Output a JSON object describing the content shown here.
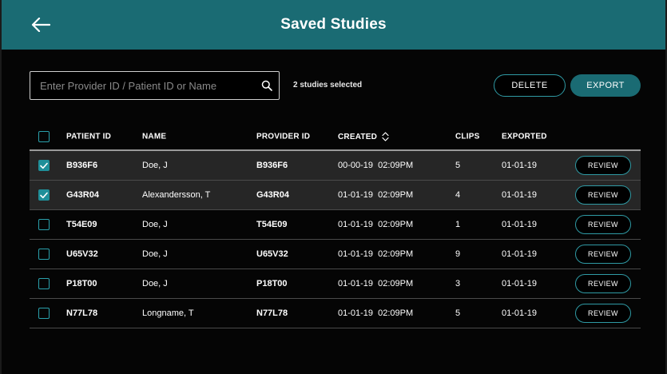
{
  "header": {
    "title": "Saved Studies",
    "back_icon": "arrow-left-icon"
  },
  "toolbar": {
    "search_placeholder": "Enter Provider ID / Patient ID or Name",
    "search_value": "",
    "search_icon": "search-icon",
    "selected_count": "2 studies selected",
    "delete_label": "DELETE",
    "export_label": "EXPORT"
  },
  "colors": {
    "header_bg": "#1a6b73",
    "accent": "#2aa0ab",
    "export_bg": "#1a6b73"
  },
  "table": {
    "columns": {
      "patient_id": "PATIENT ID",
      "name": "NAME",
      "provider_id": "PROVIDER ID",
      "created": "CREATED",
      "clips": "CLIPS",
      "exported": "EXPORTED"
    },
    "header_checked": false,
    "sort_icon": "sort-updown-icon",
    "review_label": "REVIEW",
    "rows": [
      {
        "checked": true,
        "patient_id": "B936F6",
        "name": "Doe, J",
        "provider_id": "B936F6",
        "created": "00-00-19  02:09PM",
        "clips": "5",
        "exported": "01-01-19"
      },
      {
        "checked": true,
        "patient_id": "G43R04",
        "name": "Alexandersson, T",
        "provider_id": "G43R04",
        "created": "01-01-19  02:09PM",
        "clips": "4",
        "exported": "01-01-19"
      },
      {
        "checked": false,
        "patient_id": "T54E09",
        "name": "Doe, J",
        "provider_id": "T54E09",
        "created": "01-01-19  02:09PM",
        "clips": "1",
        "exported": "01-01-19"
      },
      {
        "checked": false,
        "patient_id": "U65V32",
        "name": "Doe, J",
        "provider_id": "U65V32",
        "created": "01-01-19  02:09PM",
        "clips": "9",
        "exported": "01-01-19"
      },
      {
        "checked": false,
        "patient_id": "P18T00",
        "name": "Doe, J",
        "provider_id": "P18T00",
        "created": "01-01-19  02:09PM",
        "clips": "3",
        "exported": "01-01-19"
      },
      {
        "checked": false,
        "patient_id": "N77L78",
        "name": "Longname, T",
        "provider_id": "N77L78",
        "created": "01-01-19  02:09PM",
        "clips": "5",
        "exported": "01-01-19"
      }
    ]
  }
}
